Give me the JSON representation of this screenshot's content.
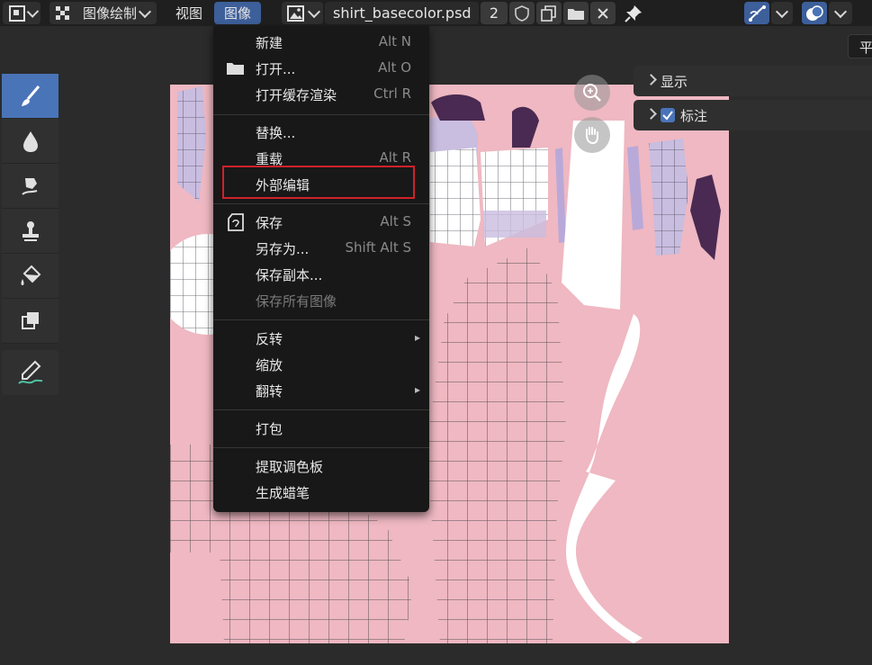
{
  "header": {
    "editor_type_icon": "image-editor-icon",
    "mode_icon": "checker-icon",
    "mode_label": "图像绘制",
    "menus": [
      "视图",
      "图像"
    ],
    "image_browse_icon": "image-icon",
    "image_name": "shirt_basecolor.psd",
    "users_count": "2",
    "icons": [
      "shield-icon",
      "duplicate-icon",
      "folder-icon",
      "close-icon",
      "pin-icon",
      "uv-sync-icon",
      "overlay-icon"
    ],
    "right_partial": "平"
  },
  "image_menu": {
    "items": [
      {
        "label": "新建",
        "shortcut": "Alt N",
        "icon": ""
      },
      {
        "label": "打开...",
        "shortcut": "Alt O",
        "icon": "folder-icon"
      },
      {
        "label": "打开缓存渲染",
        "shortcut": "Ctrl R",
        "icon": ""
      },
      {
        "label": "替换...",
        "shortcut": "",
        "icon": ""
      },
      {
        "label": "重载",
        "shortcut": "Alt R",
        "icon": ""
      },
      {
        "label": "外部编辑",
        "shortcut": "",
        "icon": ""
      },
      {
        "label": "保存",
        "shortcut": "Alt S",
        "icon": "save-icon"
      },
      {
        "label": "另存为...",
        "shortcut": "Shift Alt S",
        "icon": ""
      },
      {
        "label": "保存副本...",
        "shortcut": "",
        "icon": ""
      },
      {
        "label": "保存所有图像",
        "shortcut": "",
        "icon": "",
        "disabled": true
      },
      {
        "label": "反转",
        "shortcut": "▸",
        "icon": ""
      },
      {
        "label": "缩放",
        "shortcut": "",
        "icon": ""
      },
      {
        "label": "翻转",
        "shortcut": "▸",
        "icon": ""
      },
      {
        "label": "打包",
        "shortcut": "",
        "icon": ""
      },
      {
        "label": "提取调色板",
        "shortcut": "",
        "icon": ""
      },
      {
        "label": "生成蜡笔",
        "shortcut": "",
        "icon": ""
      }
    ],
    "highlighted": "外部编辑"
  },
  "side_panels": [
    {
      "label": "显示",
      "checkbox": false
    },
    {
      "label": "标注",
      "checkbox": true
    }
  ],
  "tools": [
    "brush-icon",
    "blur-drop-icon",
    "smear-icon",
    "clone-stamp-icon",
    "fill-icon",
    "mask-icon",
    "annotate-icon"
  ],
  "viewport_buttons": [
    "zoom-icon",
    "hand-icon"
  ],
  "colors": {
    "accent": "#4a74b8",
    "highlight_box": "#d0212a",
    "canvas": "#efb8c2"
  }
}
